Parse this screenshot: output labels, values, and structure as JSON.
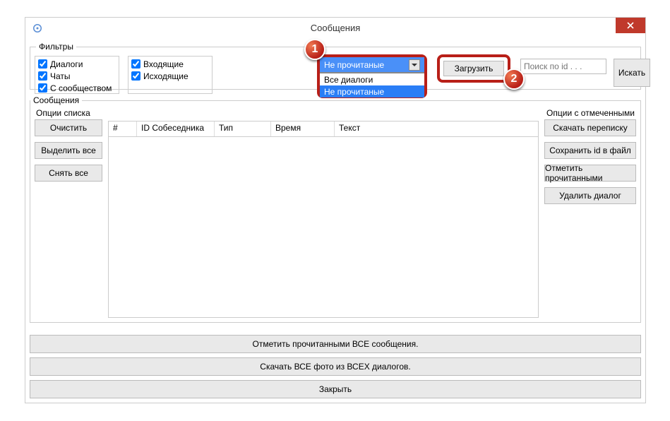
{
  "window": {
    "title": "Сообщения"
  },
  "filters": {
    "legend": "Фильтры",
    "col1": {
      "dialogs": "Диалоги",
      "chats": "Чаты",
      "community": "С сообществом"
    },
    "col2": {
      "incoming": "Входящие",
      "outgoing": "Исходящие"
    },
    "combo": {
      "selected": "Не прочитаные",
      "opt_all": "Все диалоги",
      "opt_unread": "Не прочитаные"
    },
    "load": "Загрузить",
    "search_placeholder": "Поиск по id . . .",
    "search_btn": "Искать"
  },
  "steps": {
    "one": "1",
    "two": "2"
  },
  "messages": {
    "legend": "Сообщения",
    "list_opts": "Опции списка",
    "sel_opts": "Опции с отмеченными",
    "left": {
      "clear": "Очистить",
      "select_all": "Выделить все",
      "deselect_all": "Снять все"
    },
    "right": {
      "download_conv": "Скачать переписку",
      "save_id": "Сохранить id в файл",
      "mark_read": "Отметить прочитанными",
      "delete_dialog": "Удалить диалог"
    },
    "columns": {
      "num": "#",
      "id": "ID Собеседника",
      "type": "Тип",
      "time": "Время",
      "text": "Текст"
    }
  },
  "bottom": {
    "mark_all": "Отметить прочитанными ВСЕ сообщения.",
    "download_all": "Скачать ВСЕ фото из ВСЕХ диалогов.",
    "close": "Закрыть"
  }
}
